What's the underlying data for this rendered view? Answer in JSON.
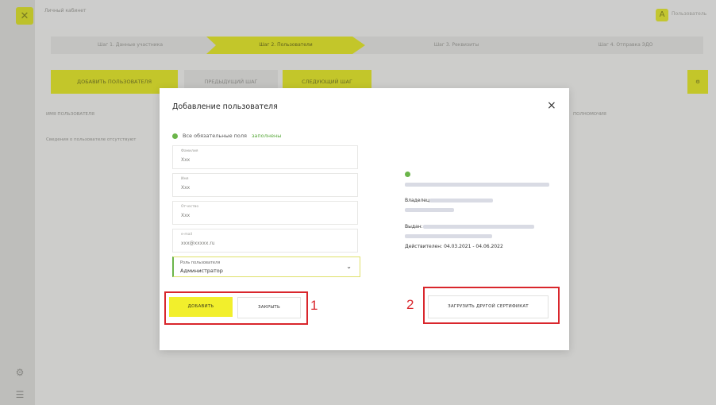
{
  "app": {
    "title": "Личный кабинет",
    "user_name": "Пользователь",
    "user_initial": "А"
  },
  "steps": [
    {
      "label": "Шаг 1. Данные участника"
    },
    {
      "label": "Шаг 2. Пользователи"
    },
    {
      "label": "Шаг 3. Реквизиты"
    },
    {
      "label": "Шаг 4. Отправка ЭДО"
    }
  ],
  "toolbar": {
    "add_user": "ДОБАВИТЬ ПОЛЬЗОВАТЕЛЯ",
    "prev_step": "ПРЕДЫДУЩИЙ ШАГ",
    "next_step": "СЛЕДУЮЩИЙ ШАГ"
  },
  "table": {
    "col_left": "ИМЯ ПОЛЬЗОВАТЕЛЯ",
    "col_right": "ПОЛНОМОЧИЯ",
    "row_text": "Сведения о пользователе отсутствуют"
  },
  "modal": {
    "title": "Добавление пользователя",
    "close": "×",
    "required_note_prefix": "Все обязательные поля",
    "required_note_accent": "заполнены",
    "fields": [
      {
        "label": "Фамилия",
        "value": "Ххх"
      },
      {
        "label": "Имя",
        "value": "Ххх"
      },
      {
        "label": "Отчество",
        "value": "Ххх"
      },
      {
        "label": "e-mail",
        "value": "xxx@xxxxx.ru"
      }
    ],
    "role": {
      "label": "Роль пользователя",
      "value": "Администратор",
      "chevron": "⌄"
    },
    "cert": {
      "snils_label": "Владелец:",
      "issued_label": "Выдан:",
      "valid": "Действителен: 04.03.2021 - 04.06.2022"
    },
    "buttons": {
      "add": "ДОБАВИТЬ",
      "close": "ЗАКРЫТЬ",
      "upload_cert": "ЗАГРУЗИТЬ ДРУГОЙ СЕРТИФИКАТ"
    }
  },
  "annotations": {
    "n1": "1",
    "n2": "2",
    "color": "#d9262c"
  }
}
